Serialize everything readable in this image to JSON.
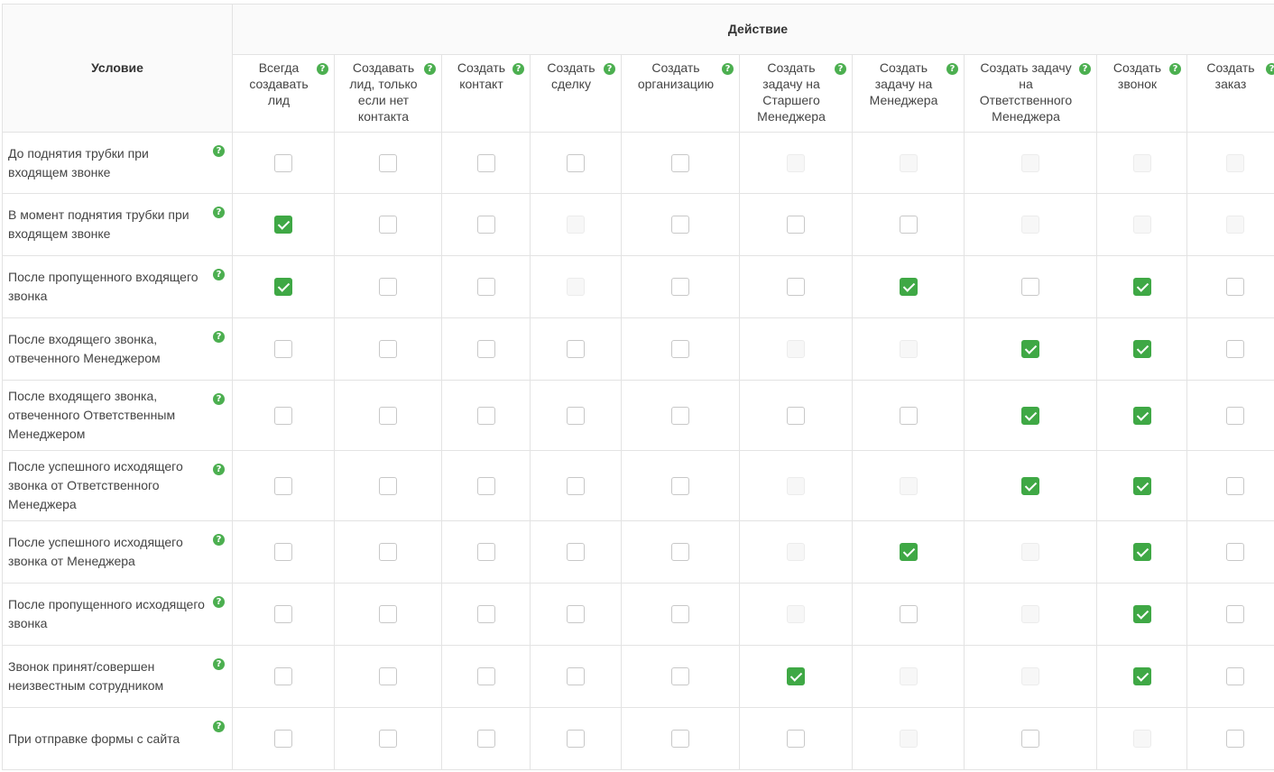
{
  "header": {
    "condition_label": "Условие",
    "action_label": "Действие",
    "help_glyph": "?",
    "columns": [
      {
        "label": "Всегда создавать лид"
      },
      {
        "label": "Создавать лид, только если нет контакта"
      },
      {
        "label": "Создать контакт"
      },
      {
        "label": "Создать сделку"
      },
      {
        "label": "Создать организацию"
      },
      {
        "label": "Создать задачу на Старшего Менеджера"
      },
      {
        "label": "Создать задачу на Менеджера"
      },
      {
        "label": "Создать задачу на Ответственного Менеджера"
      },
      {
        "label": "Создать звонок"
      },
      {
        "label": "Создать заказ"
      }
    ]
  },
  "rows": [
    {
      "condition": "До поднятия трубки при входящем звонке",
      "cells": [
        "unchecked",
        "unchecked",
        "unchecked",
        "unchecked",
        "unchecked",
        "disabled",
        "disabled",
        "disabled",
        "disabled",
        "disabled"
      ]
    },
    {
      "condition": "В момент поднятия трубки при входящем звонке",
      "cells": [
        "checked",
        "unchecked",
        "unchecked",
        "disabled",
        "unchecked",
        "unchecked",
        "unchecked",
        "disabled",
        "disabled",
        "disabled"
      ]
    },
    {
      "condition": "После пропущенного входящего звонка",
      "cells": [
        "checked",
        "unchecked",
        "unchecked",
        "disabled",
        "unchecked",
        "unchecked",
        "checked",
        "unchecked",
        "checked",
        "unchecked"
      ]
    },
    {
      "condition": "После входящего звонка, отвеченного Менеджером",
      "cells": [
        "unchecked",
        "unchecked",
        "unchecked",
        "unchecked",
        "unchecked",
        "disabled",
        "disabled",
        "checked",
        "checked",
        "unchecked"
      ]
    },
    {
      "condition": "После входящего звонка, отвеченного Ответственным Менеджером",
      "cells": [
        "unchecked",
        "unchecked",
        "unchecked",
        "unchecked",
        "unchecked",
        "unchecked",
        "unchecked",
        "checked",
        "checked",
        "unchecked"
      ]
    },
    {
      "condition": "После успешного исходящего звонка от Ответственного Менеджера",
      "cells": [
        "unchecked",
        "unchecked",
        "unchecked",
        "unchecked",
        "unchecked",
        "disabled",
        "disabled",
        "checked",
        "checked",
        "unchecked"
      ]
    },
    {
      "condition": "После успешного исходящего звонка от Менеджера",
      "cells": [
        "unchecked",
        "unchecked",
        "unchecked",
        "unchecked",
        "unchecked",
        "disabled",
        "checked",
        "disabled",
        "checked",
        "unchecked"
      ]
    },
    {
      "condition": "После пропущенного исходящего звонка",
      "cells": [
        "unchecked",
        "unchecked",
        "unchecked",
        "unchecked",
        "unchecked",
        "disabled",
        "unchecked",
        "disabled",
        "checked",
        "unchecked"
      ]
    },
    {
      "condition": "Звонок принят/совершен неизвестным сотрудником",
      "cells": [
        "unchecked",
        "unchecked",
        "unchecked",
        "unchecked",
        "unchecked",
        "checked",
        "disabled",
        "disabled",
        "checked",
        "unchecked"
      ]
    },
    {
      "condition": "При отправке формы с сайта",
      "cells": [
        "unchecked",
        "unchecked",
        "unchecked",
        "unchecked",
        "unchecked",
        "unchecked",
        "disabled",
        "unchecked",
        "disabled",
        "unchecked"
      ]
    }
  ],
  "colors": {
    "accent": "#3fa845",
    "help_icon": "#4caf50",
    "border": "#e3e3e3",
    "header_bg": "#fafafa"
  }
}
